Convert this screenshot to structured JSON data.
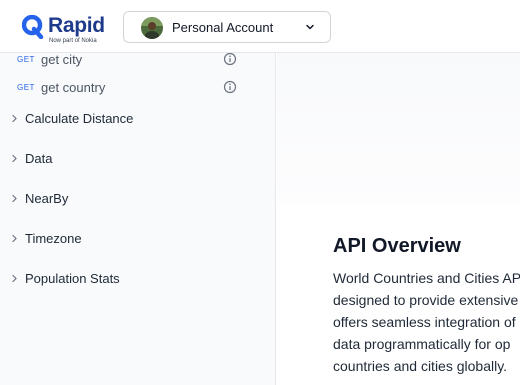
{
  "brand": {
    "name": "Rapid",
    "tagline": "Now part of Nokia",
    "color": "#1e3a8a",
    "accent": "#2563eb"
  },
  "account": {
    "label": "Personal Account",
    "icon": "chevron-down-icon"
  },
  "sidebar": {
    "endpoints": [
      {
        "method": "GET",
        "label": "get city",
        "icon": "info-icon"
      },
      {
        "method": "GET",
        "label": "get country",
        "icon": "info-icon"
      }
    ],
    "groups": [
      {
        "label": "Calculate Distance"
      },
      {
        "label": "Data"
      },
      {
        "label": "NearBy"
      },
      {
        "label": "Timezone"
      },
      {
        "label": "Population Stats"
      }
    ]
  },
  "main": {
    "section_title": "API Overview",
    "description_lines": [
      "World Countries and Cities API is",
      "designed to provide extensive",
      "offers seamless integration of",
      "data programmatically for op",
      "countries and cities globally."
    ]
  }
}
